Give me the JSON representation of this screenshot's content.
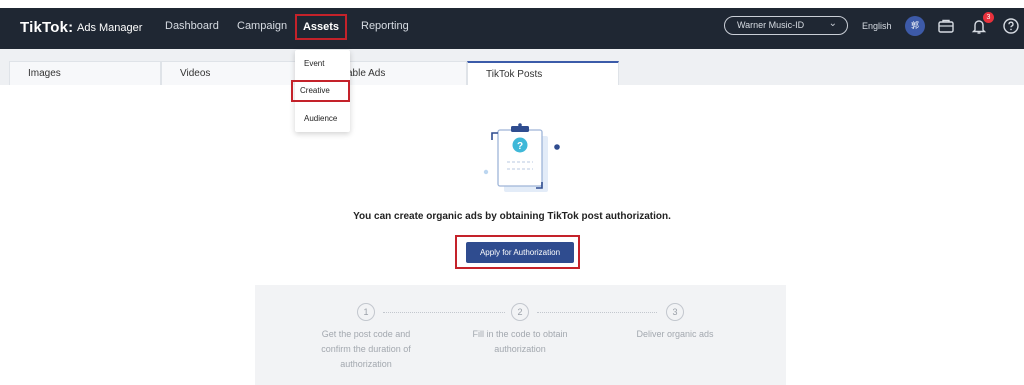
{
  "topbar": {
    "logo": "TikTok",
    "logo_colon": ":",
    "logo_sub": "Ads Manager",
    "nav": [
      "Dashboard",
      "Campaign",
      "Assets",
      "Reporting"
    ],
    "account": "Warner Music-ID",
    "language": "English",
    "avatar_text": "郭",
    "notification_count": "3"
  },
  "dropdown": {
    "items": [
      "Event",
      "Creative",
      "Audience"
    ]
  },
  "tabs": [
    "Images",
    "Videos",
    "able Ads",
    "TikTok Posts"
  ],
  "main": {
    "message": "You can create organic ads by obtaining TikTok post authorization.",
    "button": "Apply for Authorization"
  },
  "steps": [
    {
      "number": "1",
      "line1": "Get the post code and",
      "line2": "confirm the duration of",
      "line3": "authorization"
    },
    {
      "number": "2",
      "line1": "Fill in the code to obtain",
      "line2": "authorization",
      "line3": ""
    },
    {
      "number": "3",
      "line1": "Deliver organic ads",
      "line2": "",
      "line3": ""
    }
  ],
  "colors": {
    "topbar": "#1f2733",
    "accent": "#2f4c8f",
    "highlight": "#c4222a"
  }
}
